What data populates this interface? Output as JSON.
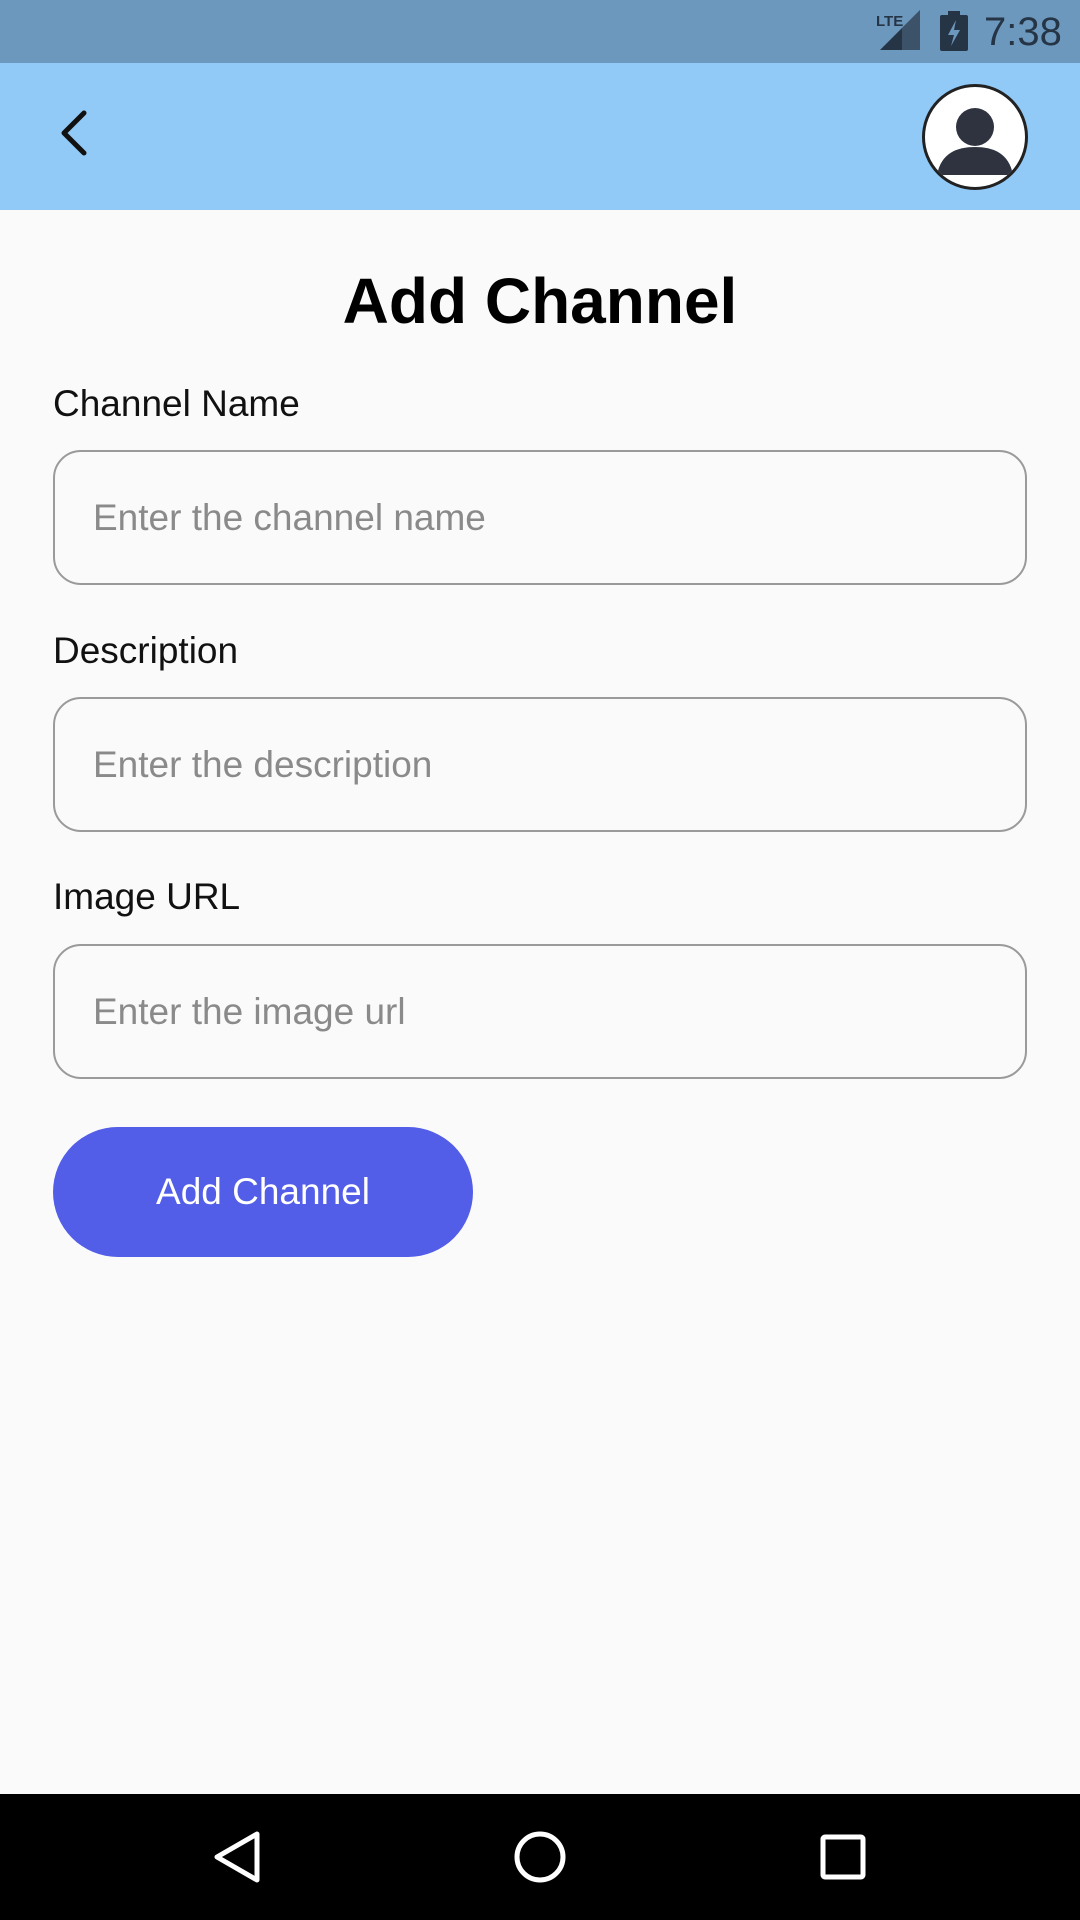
{
  "status_bar": {
    "time": "7:38",
    "network_label": "LTE",
    "icons": [
      "lte-signal-icon",
      "battery-charging-icon"
    ],
    "background": "#6d98bd"
  },
  "app_bar": {
    "background": "#91c9f7",
    "icons": [
      "back-arrow-icon",
      "account-circle-icon"
    ]
  },
  "page": {
    "title": "Add Channel"
  },
  "form": {
    "channel_name": {
      "label": "Channel Name",
      "placeholder": "Enter the channel name",
      "value": ""
    },
    "description": {
      "label": "Description",
      "placeholder": "Enter the description",
      "value": ""
    },
    "image_url": {
      "label": "Image URL",
      "placeholder": "Enter the image url",
      "value": ""
    },
    "submit_label": "Add Channel",
    "submit_color": "#525de8"
  },
  "nav_bar": {
    "icons": [
      "nav-back-icon",
      "nav-home-icon",
      "nav-recents-icon"
    ]
  }
}
